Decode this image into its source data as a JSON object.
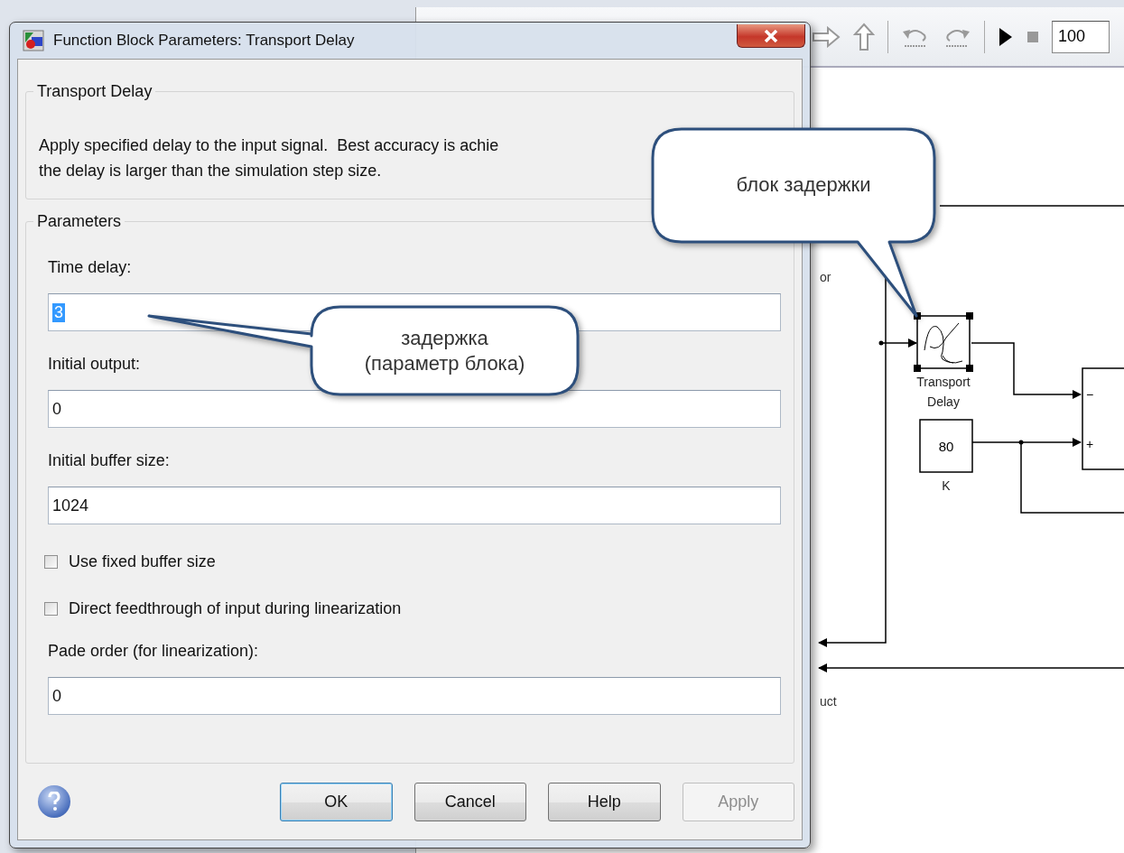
{
  "dialog": {
    "title": "Function Block Parameters: Transport Delay",
    "block_group": {
      "title": "Transport Delay",
      "description": "Apply specified delay to the input signal.  Best accuracy is achie\nthe delay is larger than the simulation step size."
    },
    "parameters": {
      "title": "Parameters",
      "items": [
        {
          "kind": "field",
          "label": "Time delay:",
          "value": "3",
          "highlighted": true
        },
        {
          "kind": "field",
          "label": "Initial output:",
          "value": "0",
          "highlighted": false
        },
        {
          "kind": "field",
          "label": "Initial buffer size:",
          "value": "1024",
          "highlighted": false
        },
        {
          "kind": "checkbox",
          "label": "Use fixed buffer size",
          "checked": false
        },
        {
          "kind": "checkbox",
          "label": "Direct feedthrough of input during linearization",
          "checked": false
        },
        {
          "kind": "field",
          "label": "Pade order (for linearization):",
          "value": "0",
          "highlighted": false
        }
      ]
    },
    "buttons": [
      {
        "label": "OK",
        "default": true,
        "disabled": false
      },
      {
        "label": "Cancel",
        "default": false,
        "disabled": false
      },
      {
        "label": "Help",
        "default": false,
        "disabled": false
      },
      {
        "label": "Apply",
        "default": false,
        "disabled": true
      }
    ]
  },
  "model": {
    "toolbar": {
      "stop_time": "100"
    },
    "blocks": [
      {
        "kind": "transport_delay",
        "label_lines": [
          "Transport",
          "Delay"
        ],
        "selected": true
      },
      {
        "kind": "gain",
        "value": "80",
        "label_lines": [
          "K"
        ],
        "selected": false
      }
    ],
    "sum_signs": [
      "−",
      "+"
    ],
    "label_fragments": [
      "or",
      "uct"
    ]
  },
  "callouts": [
    {
      "text": "блок задержки"
    },
    {
      "text": "задержка\n(параметр блока)"
    }
  ]
}
